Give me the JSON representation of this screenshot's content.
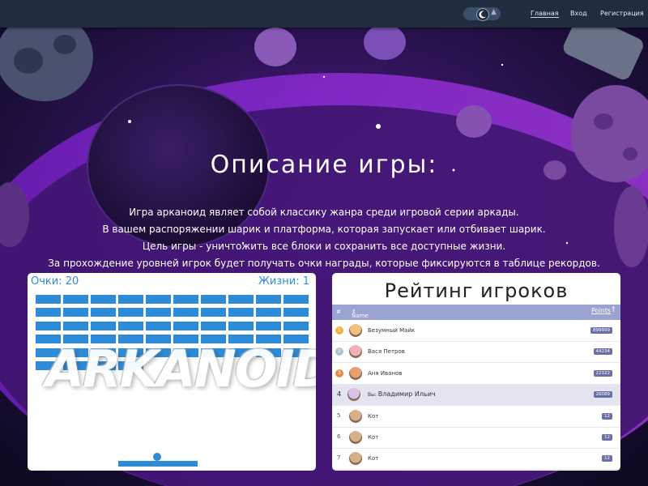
{
  "nav": {
    "home": "Главная",
    "login": "Вход",
    "register": "Регистрация",
    "theme_toggle_icon": "moon-icon"
  },
  "description": {
    "title": "Описание игры:",
    "lines": [
      "Игра арканоид являет собой классику жанра среди игровой серии аркады.",
      "В вашем распоряжении шарик и платформа, которая запускает или отбивает шарик.",
      "Цель игры - уничтожить все блоки и сохранить все доступные жизни.",
      "За прохождение уровней игрок будет получать очки награды, которые фиксируются в таблице рекордов."
    ]
  },
  "game": {
    "score": "Очки: 20",
    "lives": "Жизни: 1",
    "logo_text": "ARKANOID",
    "brick_color": "#2e8bd8"
  },
  "rating": {
    "title": "Рейтинг игроков",
    "col_num": "#",
    "col_name": "Name",
    "col_points": "Points",
    "rows": [
      {
        "rank": "1",
        "name": "Безумный Майк",
        "points": "899999",
        "medal": "#f0b43c"
      },
      {
        "rank": "2",
        "name": "Вася Петров",
        "points": "44234",
        "medal": "#a9c3d6"
      },
      {
        "rank": "3",
        "name": "Аня Иванов",
        "points": "22322",
        "medal": "#e48b4a"
      },
      {
        "rank": "4",
        "name": "Владимир Ильич",
        "prefix": "Вы:",
        "points": "26089",
        "me": true
      },
      {
        "rank": "5",
        "name": "Кот",
        "points": "12"
      },
      {
        "rank": "6",
        "name": "Кот",
        "points": "12"
      },
      {
        "rank": "7",
        "name": "Кот",
        "points": "12"
      }
    ]
  }
}
